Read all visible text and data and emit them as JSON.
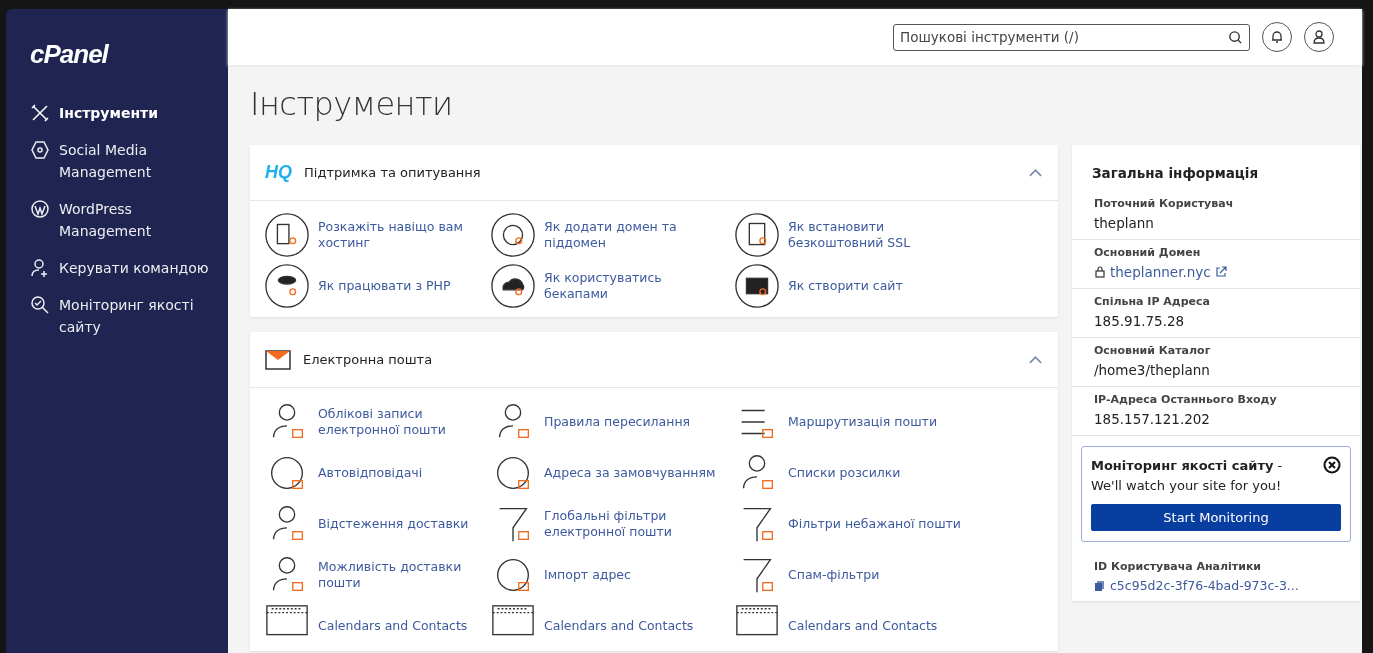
{
  "sidebar": {
    "logo": "cPanel",
    "items": [
      {
        "label": "Інструменти",
        "selected": true
      },
      {
        "label": "Social Media Management",
        "selected": false
      },
      {
        "label": "WordPress Management",
        "selected": false
      },
      {
        "label": "Керувати командою",
        "selected": false
      },
      {
        "label": "Моніторинг якості сайту",
        "selected": false
      }
    ]
  },
  "header": {
    "search": {
      "placeholder": "Пошукові інструменти (/)"
    }
  },
  "page_title": "Інструменти",
  "sections": [
    {
      "badge": "HQ",
      "title": "Підтримка та опитування",
      "expanded": true,
      "items": [
        {
          "label": "Розкажіть навіщо вам хостинг"
        },
        {
          "label": "Як додати домен та піддомен"
        },
        {
          "label": "Як встановити безкоштовний SSL"
        },
        {
          "label": "Як працювати з PHP"
        },
        {
          "label": "Як користуватись бекапами"
        },
        {
          "label": "Як створити сайт"
        }
      ]
    },
    {
      "title": "Електронна пошта",
      "expanded": true,
      "items": [
        {
          "label": "Облікові записи електронної пошти"
        },
        {
          "label": "Правила пересилання"
        },
        {
          "label": "Маршрутизація пошти"
        },
        {
          "label": "Автовідповідачі"
        },
        {
          "label": "Адреса за замовчуванням"
        },
        {
          "label": "Списки розсилки"
        },
        {
          "label": "Відстеження доставки"
        },
        {
          "label": "Глобальні фільтри електронної пошти"
        },
        {
          "label": "Фільтри небажаної пошти"
        },
        {
          "label": "Можливість доставки пошти"
        },
        {
          "label": "Імпорт адрес"
        },
        {
          "label": "Спам-фільтри"
        },
        {
          "label": "Calendars and Contacts"
        },
        {
          "label": "Calendars and Contacts"
        },
        {
          "label": "Calendars and Contacts"
        }
      ]
    }
  ],
  "info": {
    "title": "Загальна інформація",
    "rows": [
      {
        "label": "Поточний Користувач",
        "value": "theplann",
        "kind": "text"
      },
      {
        "label": "Основний Домен",
        "value": "theplanner.nyc",
        "kind": "domain"
      },
      {
        "label": "Спільна IP Адреса",
        "value": "185.91.75.28",
        "kind": "text"
      },
      {
        "label": "Основний Каталог",
        "value": "/home3/theplann",
        "kind": "text"
      },
      {
        "label": "IP-Адреса Останнього Входу",
        "value": "185.157.121.202",
        "kind": "text"
      }
    ],
    "promo": {
      "text": "**Моніторинг якості сайту** - We'll watch your site for you!",
      "button": "Start Monitoring"
    },
    "analytics": {
      "label": "ID Користувача Аналітики",
      "value": "c5c95d2c-3f76-4bad-973c-3..."
    }
  }
}
